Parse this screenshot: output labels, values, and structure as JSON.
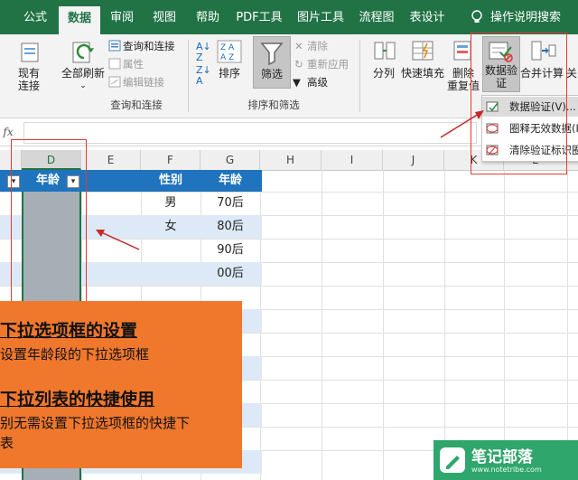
{
  "tabs": [
    "公式",
    "数据",
    "审阅",
    "视图",
    "帮助",
    "PDF工具",
    "图片工具",
    "流程图",
    "表设计"
  ],
  "active_tab": "数据",
  "tell_me": "操作说明搜索",
  "ribbon": {
    "existing_connections": "现有\n连接",
    "refresh_all": "全部刷新",
    "queries_connections": "查询和连接",
    "properties": "属性",
    "edit_links": "编辑链接",
    "group_queries": "查询和连接",
    "sort": "排序",
    "filter": "筛选",
    "clear": "清除",
    "reapply": "重新应用",
    "advanced": "高级",
    "group_sort_filter": "排序和筛选",
    "text_to_columns": "分列",
    "flash_fill": "快速填充",
    "remove_duplicates": "删除\n重复值",
    "data_validation": "数据验\n证",
    "consolidate": "合并计算",
    "relationships": "关"
  },
  "dropdown": {
    "item1": "数据验证(V)...",
    "item2": "圈释无效数据(I)",
    "item3": "清除验证标识圈(R)"
  },
  "formula_bar": {
    "fx": "fx"
  },
  "columns": [
    "D",
    "E",
    "F",
    "G",
    "H",
    "I",
    "J",
    "K",
    "L"
  ],
  "table": {
    "d_header": "年龄",
    "f_header": "性别",
    "g_header": "年龄",
    "f_values": [
      "男",
      "女",
      "",
      ""
    ],
    "g_values": [
      "70后",
      "80后",
      "90后",
      "00后"
    ]
  },
  "panel": {
    "title1": "下拉选项框的设置",
    "text1": "设置年龄段的下拉选项框",
    "title2": "下拉列表的快捷使用",
    "text2": "别无需设置下拉选项框的快捷下",
    "text3": "表"
  },
  "watermark": {
    "name": "笔记部落",
    "url": "www.notetribe.com"
  },
  "colors": {
    "excel_green": "#217346",
    "table_blue": "#1f74bd",
    "band": "#dde9f6",
    "highlight": "#e53935",
    "panel": "#f0782d"
  }
}
